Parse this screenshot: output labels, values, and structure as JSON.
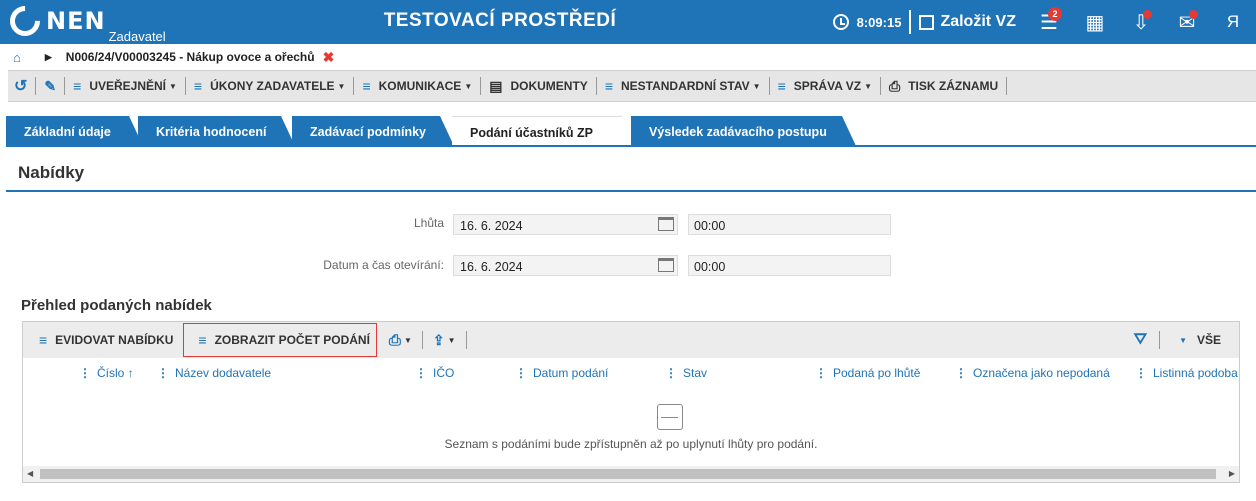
{
  "header": {
    "logo_text": "NEN",
    "logo_sub": "Zadavatel",
    "app_title": "TESTOVACÍ PROSTŘEDÍ",
    "clock_time": "8:09:15",
    "create_label": "Založit VZ",
    "menu_badge": "2",
    "icons": [
      "clock-icon",
      "pen-icon",
      "menu-icon",
      "calculator-icon",
      "inbox-icon",
      "mail-icon",
      "user-icon"
    ]
  },
  "breadcrumb": {
    "title": "N006/24/V00003245 - Nákup ovoce a ořechů",
    "close": "✖"
  },
  "toolbar": {
    "items": [
      {
        "label": "UVEŘEJNĚNÍ",
        "dropdown": true
      },
      {
        "label": "ÚKONY ZADAVATELE",
        "dropdown": true
      },
      {
        "label": "KOMUNIKACE",
        "dropdown": true
      },
      {
        "label": "DOKUMENTY",
        "dropdown": false
      },
      {
        "label": "NESTANDARDNÍ STAV",
        "dropdown": true
      },
      {
        "label": "SPRÁVA VZ",
        "dropdown": true
      },
      {
        "label": "TISK ZÁZNAMU",
        "dropdown": false
      }
    ]
  },
  "tabs": [
    {
      "label": "Základní údaje"
    },
    {
      "label": "Kritéria hodnocení"
    },
    {
      "label": "Zadávací podmínky"
    },
    {
      "label": "Podání účastníků ZP"
    },
    {
      "label": "Výsledek zadávacího postupu"
    }
  ],
  "section": {
    "title": "Nabídky",
    "deadline_label": "Lhůta",
    "deadline_date": "16. 6. 2024",
    "deadline_time": "00:00",
    "opening_label": "Datum a čas otevírání:",
    "opening_date": "16. 6. 2024",
    "opening_time": "00:00"
  },
  "grid": {
    "title": "Přehled podaných nabídek",
    "record_offer": "EVIDOVAT NABÍDKU",
    "show_count": "ZOBRAZIT POČET PODÁNÍ",
    "filter_all": "VŠE",
    "columns": [
      {
        "label": "Číslo ↑"
      },
      {
        "label": "Název dodavatele"
      },
      {
        "label": "IČO"
      },
      {
        "label": "Datum podání"
      },
      {
        "label": "Stav"
      },
      {
        "label": "Podaná po lhůtě"
      },
      {
        "label": "Označena jako nepodaná"
      },
      {
        "label": "Listinná podoba"
      }
    ],
    "empty_message": "Seznam s podáními bude zpřístupněn až po uplynutí lhůty pro podání."
  },
  "colors": {
    "primary": "#1f73b7",
    "alert": "#e53935",
    "toolbar_bg": "#e6e6e6"
  }
}
